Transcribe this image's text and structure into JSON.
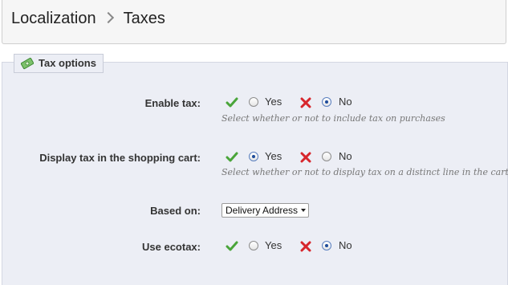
{
  "breadcrumb": {
    "parent": "Localization",
    "current": "Taxes"
  },
  "panel": {
    "legend": "Tax options"
  },
  "fields": [
    {
      "label": "Enable tax:",
      "yes": "Yes",
      "no": "No",
      "selected": "no",
      "help": "Select whether or not to include tax on purchases"
    },
    {
      "label": "Display tax in the shopping cart:",
      "yes": "Yes",
      "no": "No",
      "selected": "yes",
      "help": "Select whether or not to display tax on a distinct line in the cart."
    },
    {
      "label": "Based on:",
      "value": "Delivery Address"
    },
    {
      "label": "Use ecotax:",
      "yes": "Yes",
      "no": "No",
      "selected": "no"
    }
  ],
  "colors": {
    "check": "#4aa53a",
    "cross": "#d7262c",
    "panel_bg": "#eceef5"
  },
  "icons": {
    "legend": "money-icon",
    "yes": "check-icon",
    "no": "cross-icon"
  }
}
